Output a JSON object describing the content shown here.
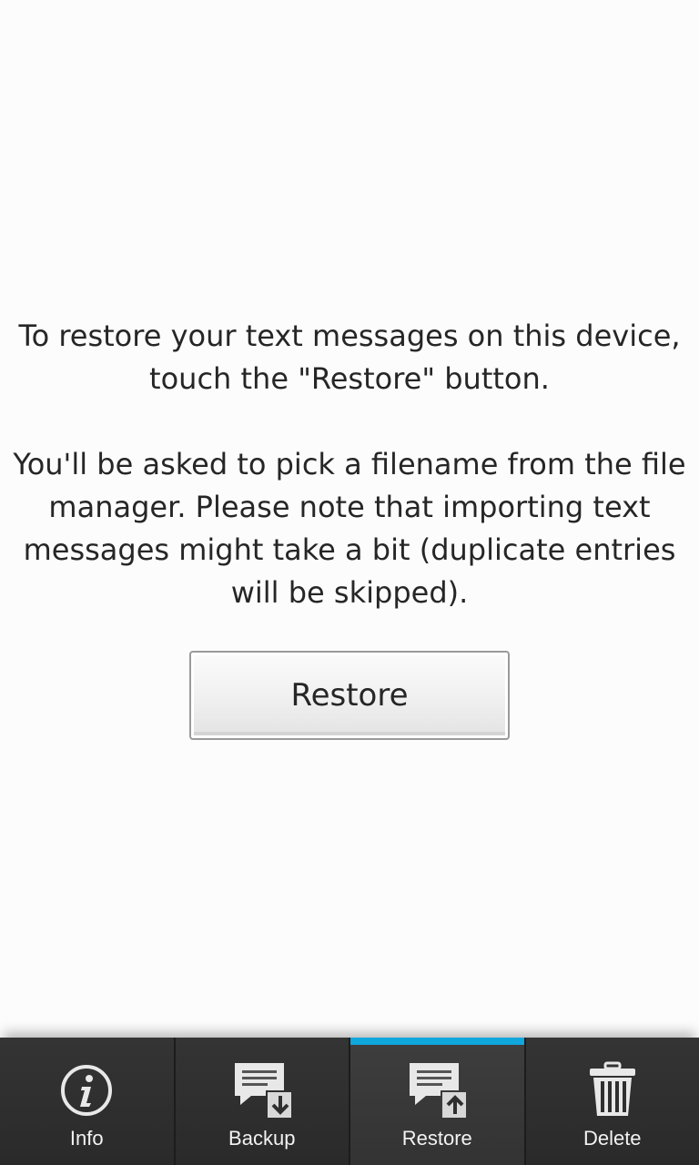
{
  "main": {
    "paragraph_1": "To restore your text messages on this device, touch the \"Restore\" button.",
    "paragraph_2": "You'll be asked to pick a filename from the file manager. Please note that importing text messages might take a bit (duplicate entries will be skipped).",
    "restore_button_label": "Restore"
  },
  "action_bar": {
    "tabs": [
      {
        "label": "Info",
        "icon": "info-icon"
      },
      {
        "label": "Backup",
        "icon": "backup-icon"
      },
      {
        "label": "Restore",
        "icon": "restore-icon",
        "active": true
      },
      {
        "label": "Delete",
        "icon": "trash-icon"
      }
    ]
  },
  "colors": {
    "background": "#fcfcfc",
    "text": "#262626",
    "action_bar": "#2f2f2f",
    "active_indicator": "#10a7dd",
    "tab_label": "#f2f2f2"
  }
}
